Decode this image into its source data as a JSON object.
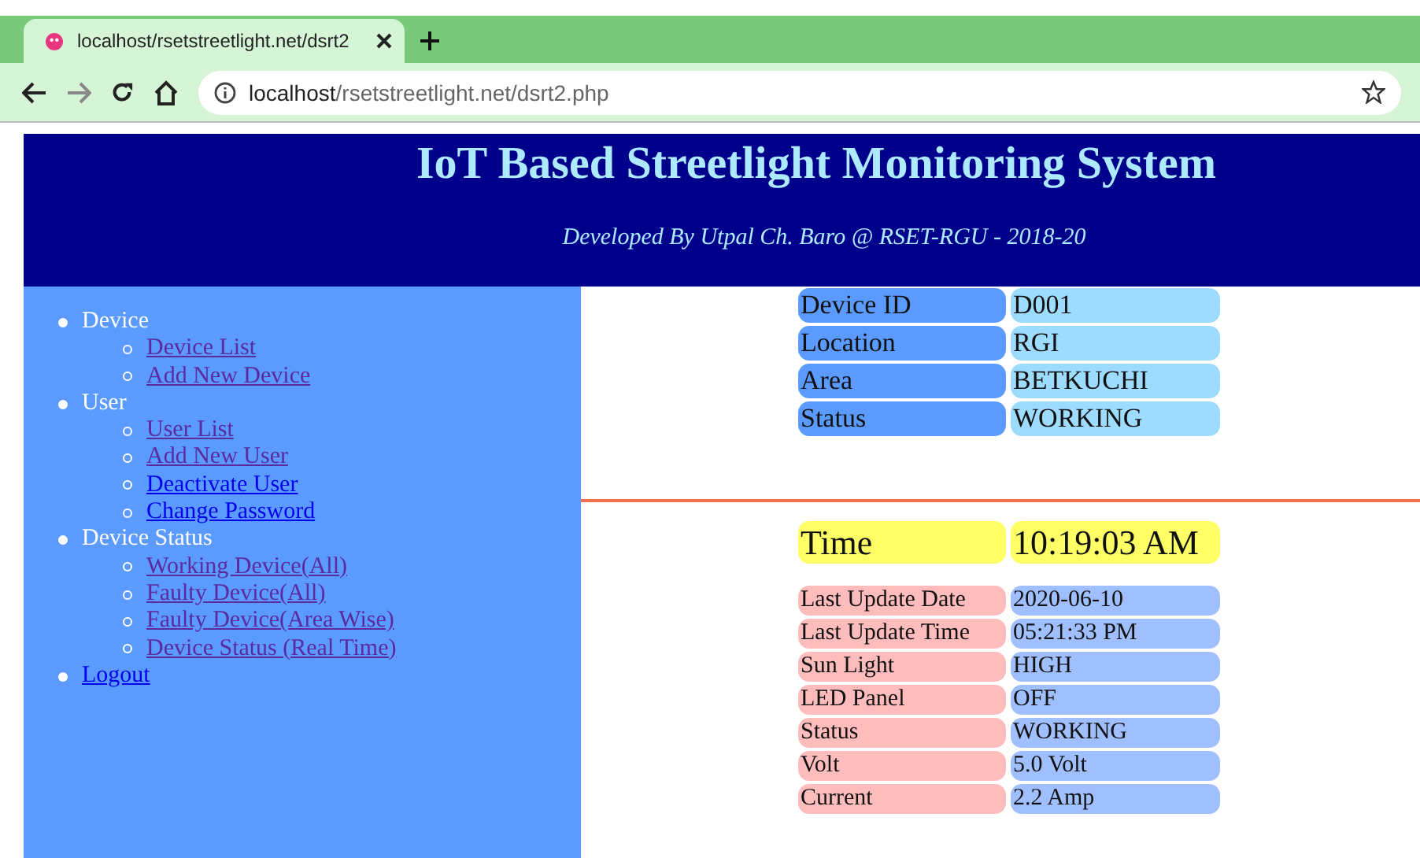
{
  "browser": {
    "tab_title": "localhost/rsetstreetlight.net/dsrt2",
    "url_host": "localhost",
    "url_path": "/rsetstreetlight.net/dsrt2.php"
  },
  "header": {
    "title": "IoT Based Streetlight Monitoring System",
    "subtitle": "Developed By Utpal Ch. Baro @ RSET-RGU - 2018-20"
  },
  "sidebar": {
    "items": [
      {
        "label": "Device",
        "kind": "heading",
        "children": [
          {
            "label": "Device List",
            "visited": true
          },
          {
            "label": "Add New Device",
            "visited": true
          }
        ]
      },
      {
        "label": "User",
        "kind": "heading",
        "children": [
          {
            "label": "User List",
            "visited": true
          },
          {
            "label": "Add New User",
            "visited": true
          },
          {
            "label": "Deactivate User",
            "visited": false
          },
          {
            "label": "Change Password",
            "visited": false
          }
        ]
      },
      {
        "label": "Device Status",
        "kind": "heading",
        "children": [
          {
            "label": "Working Device(All)",
            "visited": true
          },
          {
            "label": "Faulty Device(All)",
            "visited": true
          },
          {
            "label": "Faulty Device(Area Wise)",
            "visited": true
          },
          {
            "label": "Device Status (Real Time)",
            "visited": true
          }
        ]
      },
      {
        "label": "Logout",
        "kind": "link",
        "visited": false
      }
    ]
  },
  "device_info": [
    {
      "label": "Device ID",
      "value": "D001"
    },
    {
      "label": "Location",
      "value": "RGI"
    },
    {
      "label": "Area",
      "value": "BETKUCHI"
    },
    {
      "label": "Status",
      "value": "WORKING"
    }
  ],
  "time": {
    "label": "Time",
    "value": "10:19:03 AM"
  },
  "readings": [
    {
      "label": "Last Update Date",
      "value": "2020-06-10"
    },
    {
      "label": "Last Update Time",
      "value": "05:21:33 PM"
    },
    {
      "label": "Sun Light",
      "value": "HIGH"
    },
    {
      "label": "LED Panel",
      "value": "OFF"
    },
    {
      "label": "Status",
      "value": "WORKING"
    },
    {
      "label": "Volt",
      "value": "5.0 Volt"
    },
    {
      "label": "Current",
      "value": "2.2 Amp"
    }
  ]
}
